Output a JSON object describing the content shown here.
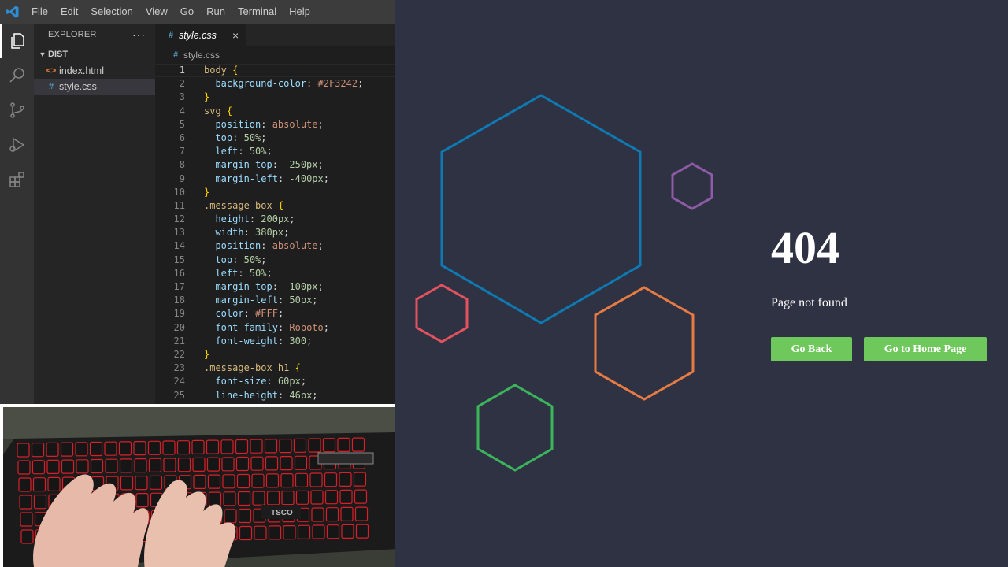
{
  "menubar": {
    "logo_icon": "vscode-logo-icon",
    "items": [
      "File",
      "Edit",
      "Selection",
      "View",
      "Go",
      "Run",
      "Terminal",
      "Help"
    ]
  },
  "activity_bar": {
    "icons": [
      "explorer-icon",
      "search-icon",
      "source-control-icon",
      "run-debug-icon",
      "extensions-icon"
    ]
  },
  "explorer": {
    "title": "EXPLORER",
    "more": "···",
    "folder": "DIST",
    "files": [
      {
        "icon": "<>",
        "name": "index.html",
        "type": "html"
      },
      {
        "icon": "#",
        "name": "style.css",
        "type": "css",
        "selected": true
      }
    ]
  },
  "editor": {
    "tab": {
      "icon": "#",
      "name": "style.css",
      "close": "×"
    },
    "breadcrumb": {
      "icon": "#",
      "name": "style.css"
    },
    "current_line": 1,
    "lines": [
      {
        "n": "1",
        "t": [
          [
            "sel",
            "body"
          ],
          [
            "punc",
            " "
          ],
          [
            "br",
            "{"
          ]
        ]
      },
      {
        "n": "2",
        "t": [
          [
            "punc",
            "  "
          ],
          [
            "prop",
            "background-color"
          ],
          [
            "punc",
            ": "
          ],
          [
            "val",
            "#2F3242"
          ],
          [
            "punc",
            ";"
          ]
        ]
      },
      {
        "n": "3",
        "t": [
          [
            "br",
            "}"
          ]
        ]
      },
      {
        "n": "4",
        "t": [
          [
            "sel",
            "svg"
          ],
          [
            "punc",
            " "
          ],
          [
            "br",
            "{"
          ]
        ]
      },
      {
        "n": "5",
        "t": [
          [
            "punc",
            "  "
          ],
          [
            "prop",
            "position"
          ],
          [
            "punc",
            ": "
          ],
          [
            "val",
            "absolute"
          ],
          [
            "punc",
            ";"
          ]
        ]
      },
      {
        "n": "6",
        "t": [
          [
            "punc",
            "  "
          ],
          [
            "prop",
            "top"
          ],
          [
            "punc",
            ": "
          ],
          [
            "num",
            "50%"
          ],
          [
            "punc",
            ";"
          ]
        ]
      },
      {
        "n": "7",
        "t": [
          [
            "punc",
            "  "
          ],
          [
            "prop",
            "left"
          ],
          [
            "punc",
            ": "
          ],
          [
            "num",
            "50%"
          ],
          [
            "punc",
            ";"
          ]
        ]
      },
      {
        "n": "8",
        "t": [
          [
            "punc",
            "  "
          ],
          [
            "prop",
            "margin-top"
          ],
          [
            "punc",
            ": "
          ],
          [
            "num",
            "-250px"
          ],
          [
            "punc",
            ";"
          ]
        ]
      },
      {
        "n": "9",
        "t": [
          [
            "punc",
            "  "
          ],
          [
            "prop",
            "margin-left"
          ],
          [
            "punc",
            ": "
          ],
          [
            "num",
            "-400px"
          ],
          [
            "punc",
            ";"
          ]
        ]
      },
      {
        "n": "10",
        "t": [
          [
            "br",
            "}"
          ]
        ]
      },
      {
        "n": "11",
        "t": [
          [
            "sel",
            ".message-box"
          ],
          [
            "punc",
            " "
          ],
          [
            "br",
            "{"
          ]
        ]
      },
      {
        "n": "12",
        "t": [
          [
            "punc",
            "  "
          ],
          [
            "prop",
            "height"
          ],
          [
            "punc",
            ": "
          ],
          [
            "num",
            "200px"
          ],
          [
            "punc",
            ";"
          ]
        ]
      },
      {
        "n": "13",
        "t": [
          [
            "punc",
            "  "
          ],
          [
            "prop",
            "width"
          ],
          [
            "punc",
            ": "
          ],
          [
            "num",
            "380px"
          ],
          [
            "punc",
            ";"
          ]
        ]
      },
      {
        "n": "14",
        "t": [
          [
            "punc",
            "  "
          ],
          [
            "prop",
            "position"
          ],
          [
            "punc",
            ": "
          ],
          [
            "val",
            "absolute"
          ],
          [
            "punc",
            ";"
          ]
        ]
      },
      {
        "n": "15",
        "t": [
          [
            "punc",
            "  "
          ],
          [
            "prop",
            "top"
          ],
          [
            "punc",
            ": "
          ],
          [
            "num",
            "50%"
          ],
          [
            "punc",
            ";"
          ]
        ]
      },
      {
        "n": "16",
        "t": [
          [
            "punc",
            "  "
          ],
          [
            "prop",
            "left"
          ],
          [
            "punc",
            ": "
          ],
          [
            "num",
            "50%"
          ],
          [
            "punc",
            ";"
          ]
        ]
      },
      {
        "n": "17",
        "t": [
          [
            "punc",
            "  "
          ],
          [
            "prop",
            "margin-top"
          ],
          [
            "punc",
            ": "
          ],
          [
            "num",
            "-100px"
          ],
          [
            "punc",
            ";"
          ]
        ]
      },
      {
        "n": "18",
        "t": [
          [
            "punc",
            "  "
          ],
          [
            "prop",
            "margin-left"
          ],
          [
            "punc",
            ": "
          ],
          [
            "num",
            "50px"
          ],
          [
            "punc",
            ";"
          ]
        ]
      },
      {
        "n": "19",
        "t": [
          [
            "punc",
            "  "
          ],
          [
            "prop",
            "color"
          ],
          [
            "punc",
            ": "
          ],
          [
            "val",
            "#FFF"
          ],
          [
            "punc",
            ";"
          ]
        ]
      },
      {
        "n": "20",
        "t": [
          [
            "punc",
            "  "
          ],
          [
            "prop",
            "font-family"
          ],
          [
            "punc",
            ": "
          ],
          [
            "val",
            "Roboto"
          ],
          [
            "punc",
            ";"
          ]
        ]
      },
      {
        "n": "21",
        "t": [
          [
            "punc",
            "  "
          ],
          [
            "prop",
            "font-weight"
          ],
          [
            "punc",
            ": "
          ],
          [
            "num",
            "300"
          ],
          [
            "punc",
            ";"
          ]
        ]
      },
      {
        "n": "22",
        "t": [
          [
            "br",
            "}"
          ]
        ]
      },
      {
        "n": "23",
        "t": [
          [
            "sel",
            ".message-box h1"
          ],
          [
            "punc",
            " "
          ],
          [
            "br",
            "{"
          ]
        ]
      },
      {
        "n": "24",
        "t": [
          [
            "punc",
            "  "
          ],
          [
            "prop",
            "font-size"
          ],
          [
            "punc",
            ": "
          ],
          [
            "num",
            "60px"
          ],
          [
            "punc",
            ";"
          ]
        ]
      },
      {
        "n": "25",
        "t": [
          [
            "punc",
            "  "
          ],
          [
            "prop",
            "line-height"
          ],
          [
            "punc",
            ": "
          ],
          [
            "num",
            "46px"
          ],
          [
            "punc",
            ";"
          ]
        ]
      }
    ]
  },
  "webcam": {
    "icon": "keyboard-typing-video"
  },
  "preview": {
    "background": "#2F3242",
    "heading": "404",
    "message": "Page not found",
    "buttons": {
      "back": "Go Back",
      "home": "Go to Home Page"
    },
    "button_color": "#6EC85B",
    "hexagon_colors": [
      "#0E79B2",
      "#8E5BA6",
      "#E2525F",
      "#E87B43",
      "#3BB55C"
    ]
  }
}
